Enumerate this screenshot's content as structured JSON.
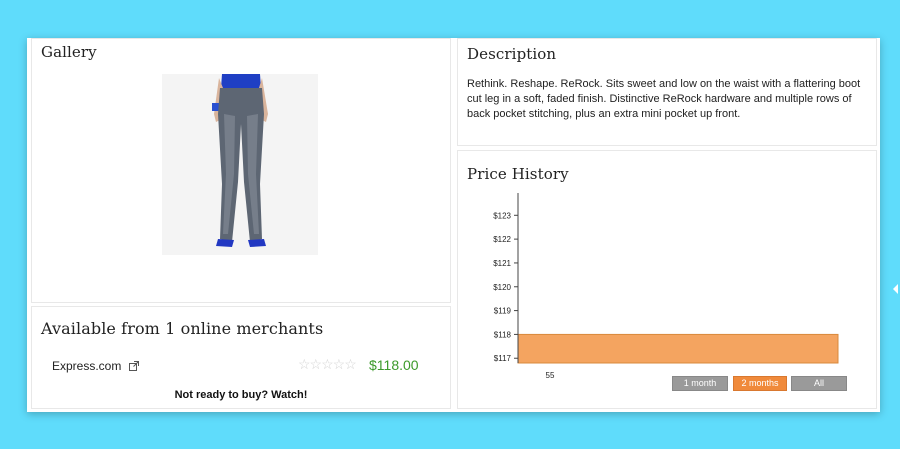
{
  "gallery": {
    "title": "Gallery",
    "image_alt": "flare jeans"
  },
  "description": {
    "title": "Description",
    "text": "Rethink. Reshape. ReRock. Sits sweet and low on the waist with a flattering boot cut leg in a soft, faded finish. Distinctive ReRock hardware and multiple rows of back pocket stitching, plus an extra mini pocket up front."
  },
  "merchants": {
    "title": "Available from 1 online merchants",
    "items": [
      {
        "name": "Express.com",
        "rating_stars": 0,
        "price": "$118.00"
      }
    ],
    "watch_label": "Not ready to buy? Watch!"
  },
  "price_history": {
    "title": "Price History",
    "ranges": [
      "1 month",
      "2 months",
      "All"
    ],
    "active_range": "2 months"
  },
  "colors": {
    "accent": "#f4a460",
    "price_green": "#3c9a2a",
    "background": "#5fdcfb"
  },
  "chart_data": {
    "type": "area",
    "title": "Price History",
    "x": [
      55
    ],
    "xticks": [
      "55"
    ],
    "yticks": [
      "$117",
      "$118",
      "$119",
      "$120",
      "$121",
      "$122",
      "$123"
    ],
    "ylim": [
      116.8,
      123.6
    ],
    "series": [
      {
        "values": [
          118,
          118
        ]
      }
    ],
    "grid": false
  }
}
